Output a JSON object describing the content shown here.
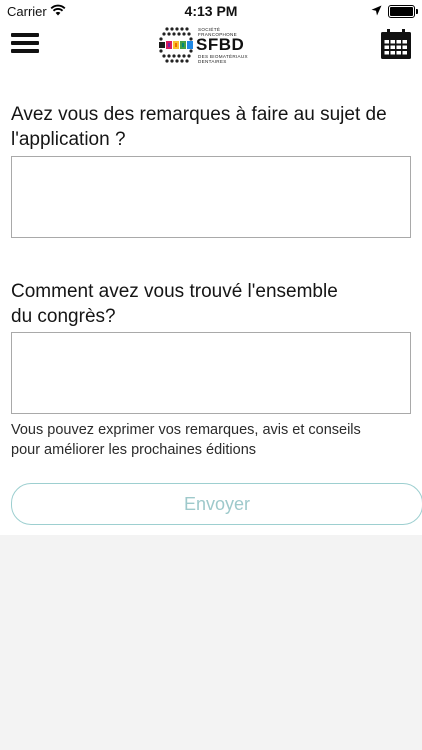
{
  "status_bar": {
    "carrier": "Carrier",
    "time": "4:13 PM"
  },
  "header": {
    "logo": {
      "top_line_1": "SOCIÉTÉ",
      "top_line_2": "FRANCOPHONE",
      "main": "SFBD",
      "bottom_line_1": "DES BIOMATÉRIAUX",
      "bottom_line_2": "DENTAIRES"
    },
    "icons": {
      "menu": "hamburger-menu-icon",
      "calendar": "calendar-icon"
    }
  },
  "form": {
    "q1_line1": "Avez vous des remarques à faire au sujet de",
    "q1_line2": "l'application ?",
    "q1_value": "",
    "q2_line1": "Comment avez vous trouvé l'ensemble",
    "q2_line2": "du congrès?",
    "q2_value": "",
    "help_line1": "Vous pouvez exprimer vos remarques, avis et conseils",
    "help_line2": "pour améliorer les prochaines éditions",
    "submit_label": "Envoyer"
  },
  "colors": {
    "button_border": "#9dcfd0",
    "button_text": "#9ec9cb",
    "background": "#f3f3f3"
  }
}
